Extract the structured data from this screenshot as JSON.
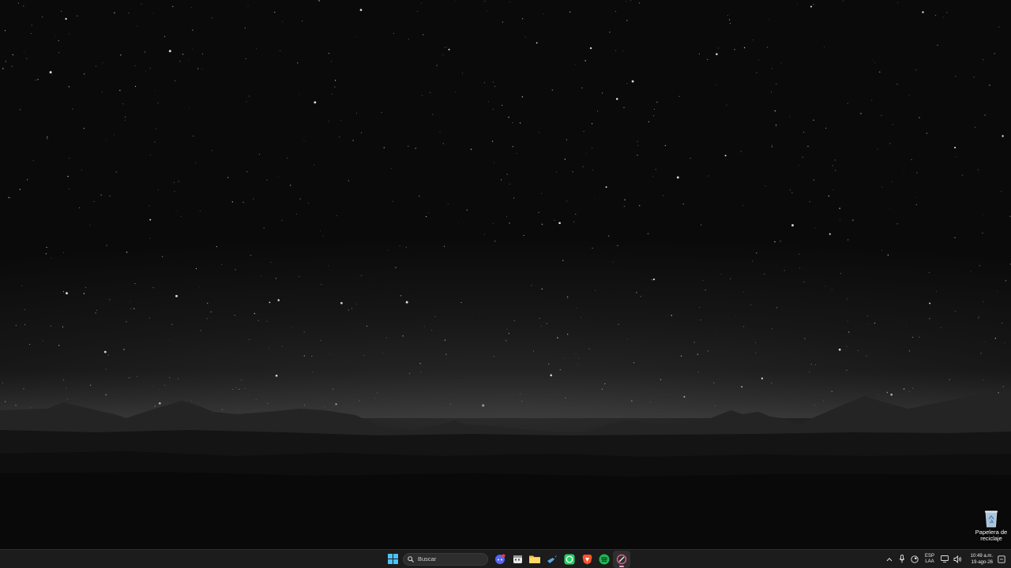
{
  "desktop": {
    "icons": [
      {
        "label": "Papelera de reciclaje",
        "icon": "recycle-bin-icon"
      }
    ]
  },
  "taskbar": {
    "start_icon": "windows-start-icon",
    "search": {
      "placeholder": "Buscar"
    },
    "pinned_apps": [
      {
        "name": "discord",
        "icon": "discord-icon",
        "color": "#5865F2"
      },
      {
        "name": "calendar",
        "icon": "calendar-icon",
        "color": "#d8d8d8"
      },
      {
        "name": "file-explorer",
        "icon": "folder-icon",
        "color": "#F2C14E"
      },
      {
        "name": "steam",
        "icon": "steam-icon",
        "color": "#5aa6e0"
      },
      {
        "name": "whatsapp",
        "icon": "whatsapp-icon",
        "color": "#25D366"
      },
      {
        "name": "brave",
        "icon": "brave-icon",
        "color": "#FB542B"
      },
      {
        "name": "spotify",
        "icon": "spotify-icon",
        "color": "#1DB954"
      },
      {
        "name": "screen-capture",
        "icon": "screenshot-icon",
        "color": "#e35b8f"
      }
    ],
    "tray": {
      "language_line1": "ESP",
      "language_line2": "LAA",
      "time": "10:49 a.m.",
      "date": "19-ago-26"
    }
  }
}
